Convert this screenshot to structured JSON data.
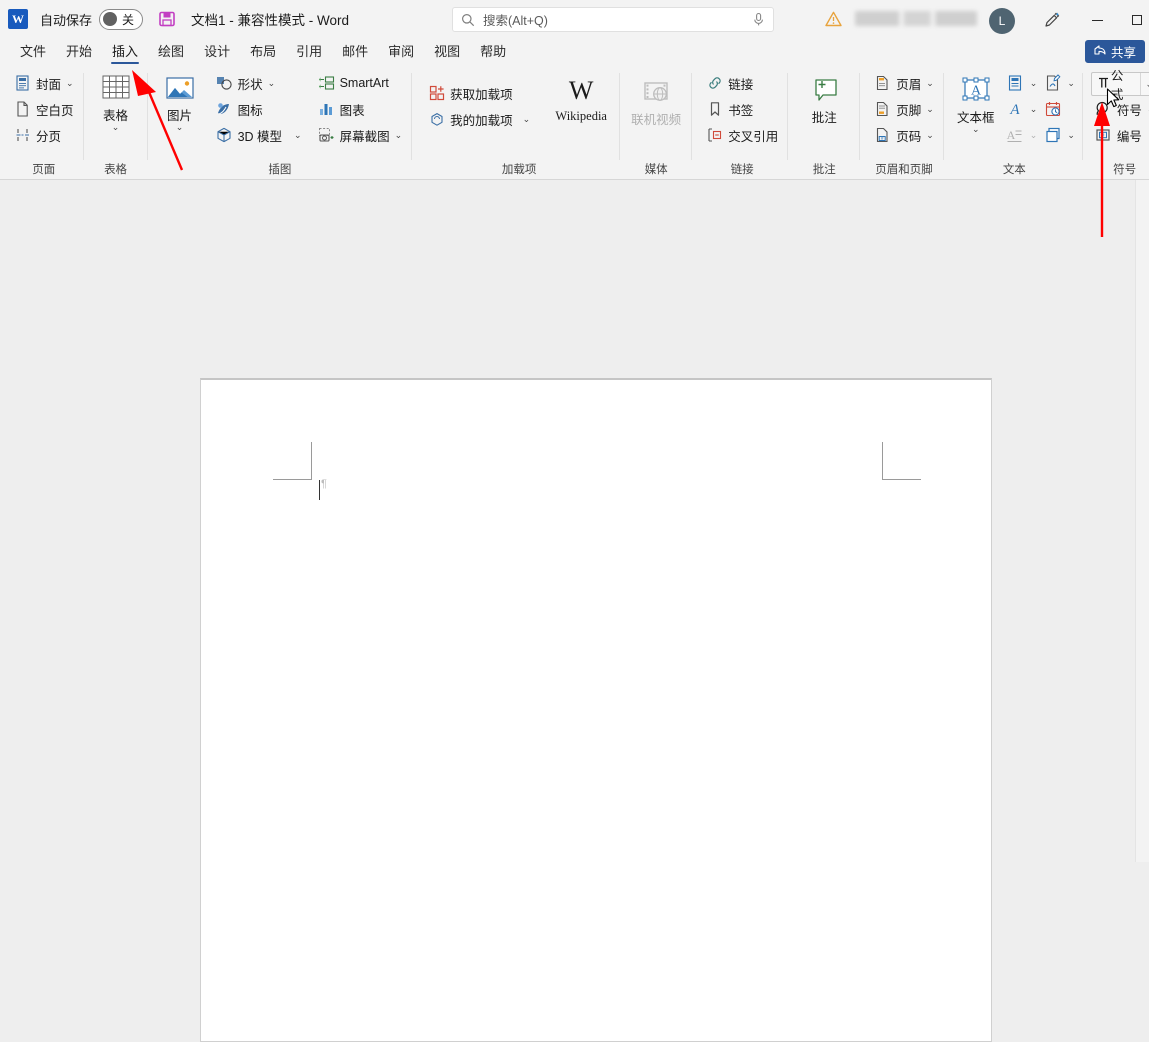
{
  "titlebar": {
    "app_icon": "word-logo",
    "autosave_label": "自动保存",
    "autosave_state": "关",
    "save_icon": "save-icon",
    "document_title": "文档1  -  兼容性模式  -  Word",
    "warning_icon": "warning-icon",
    "account_name_blurred": "",
    "avatar_initial": "L",
    "pen_icon": "pen-icon",
    "minimize_label": "—",
    "maximize_label": "□"
  },
  "search": {
    "icon": "search-icon",
    "placeholder": "搜索(Alt+Q)",
    "mic_icon": "microphone-icon"
  },
  "tabs": [
    {
      "label": "文件",
      "active": false
    },
    {
      "label": "开始",
      "active": false
    },
    {
      "label": "插入",
      "active": true
    },
    {
      "label": "绘图",
      "active": false
    },
    {
      "label": "设计",
      "active": false
    },
    {
      "label": "布局",
      "active": false
    },
    {
      "label": "引用",
      "active": false
    },
    {
      "label": "邮件",
      "active": false
    },
    {
      "label": "审阅",
      "active": false
    },
    {
      "label": "视图",
      "active": false
    },
    {
      "label": "帮助",
      "active": false
    }
  ],
  "share": {
    "label": "共享",
    "icon": "share-icon",
    "color": "#2b579a"
  },
  "ribbon": {
    "groups": [
      {
        "name": "页面",
        "label": "页面",
        "items": [
          {
            "label": "封面",
            "icon": "cover-page-icon",
            "caret": true
          },
          {
            "label": "空白页",
            "icon": "blank-page-icon",
            "caret": false
          },
          {
            "label": "分页",
            "icon": "page-break-icon",
            "caret": false
          }
        ]
      },
      {
        "name": "表格",
        "label": "表格",
        "items": [
          {
            "label": "表格",
            "icon": "table-icon",
            "caret": true
          }
        ]
      },
      {
        "name": "插图",
        "label": "插图",
        "items": [
          {
            "label": "图片",
            "icon": "picture-icon",
            "caret": true
          },
          {
            "label": "形状",
            "icon": "shapes-icon",
            "caret": true
          },
          {
            "label": "图标",
            "icon": "icons-icon",
            "caret": false
          },
          {
            "label": "3D 模型",
            "icon": "3d-model-icon",
            "caret": true
          },
          {
            "label": "SmartArt",
            "icon": "smartart-icon",
            "caret": false
          },
          {
            "label": "图表",
            "icon": "chart-icon",
            "caret": false
          },
          {
            "label": "屏幕截图",
            "icon": "screenshot-icon",
            "caret": true
          }
        ]
      },
      {
        "name": "加载项",
        "label": "加载项",
        "items": [
          {
            "label": "获取加载项",
            "icon": "get-addins-icon",
            "caret": false
          },
          {
            "label": "我的加载项",
            "icon": "my-addins-icon",
            "caret": true
          },
          {
            "label": "Wikipedia",
            "icon": "wikipedia-icon",
            "caret": false
          }
        ]
      },
      {
        "name": "媒体",
        "label": "媒体",
        "items": [
          {
            "label": "联机视频",
            "icon": "online-video-icon",
            "disabled": true
          }
        ]
      },
      {
        "name": "链接",
        "label": "链接",
        "items": [
          {
            "label": "链接",
            "icon": "link-icon",
            "caret": false
          },
          {
            "label": "书签",
            "icon": "bookmark-icon",
            "caret": false
          },
          {
            "label": "交叉引用",
            "icon": "cross-reference-icon",
            "caret": false
          }
        ]
      },
      {
        "name": "批注",
        "label": "批注",
        "items": [
          {
            "label": "批注",
            "icon": "comment-icon",
            "caret": false
          }
        ]
      },
      {
        "name": "页眉和页脚",
        "label": "页眉和页脚",
        "items": [
          {
            "label": "页眉",
            "icon": "header-icon",
            "caret": true
          },
          {
            "label": "页脚",
            "icon": "footer-icon",
            "caret": true
          },
          {
            "label": "页码",
            "icon": "page-number-icon",
            "caret": true
          }
        ]
      },
      {
        "name": "文本",
        "label": "文本",
        "items": [
          {
            "label": "文本框",
            "icon": "text-box-icon",
            "caret": true
          },
          {
            "label": "",
            "icon": "quick-parts-icon",
            "caret": true
          },
          {
            "label": "",
            "icon": "wordart-icon",
            "caret": true
          },
          {
            "label": "",
            "icon": "drop-cap-icon",
            "caret": true,
            "disabled": true
          },
          {
            "label": "",
            "icon": "signature-line-icon",
            "caret": true
          },
          {
            "label": "",
            "icon": "date-time-icon",
            "caret": false
          },
          {
            "label": "",
            "icon": "object-icon",
            "caret": true
          }
        ]
      },
      {
        "name": "符号",
        "label": "符号",
        "items": [
          {
            "label": "公式",
            "icon": "equation-icon",
            "caret": true,
            "highlighted": true
          },
          {
            "label": "符号",
            "icon": "symbol-icon",
            "caret": true
          },
          {
            "label": "编号",
            "icon": "number-icon",
            "caret": false
          }
        ]
      }
    ]
  },
  "document": {
    "page_background": "#ffffff",
    "workspace_background": "#eeeeee",
    "cursor": "text-caret"
  },
  "annotations": {
    "arrow_color": "#ff0000",
    "arrow1_target": "插入",
    "arrow2_target": "公式 下拉按钮",
    "mouse_cursor": "mouse-pointer"
  }
}
